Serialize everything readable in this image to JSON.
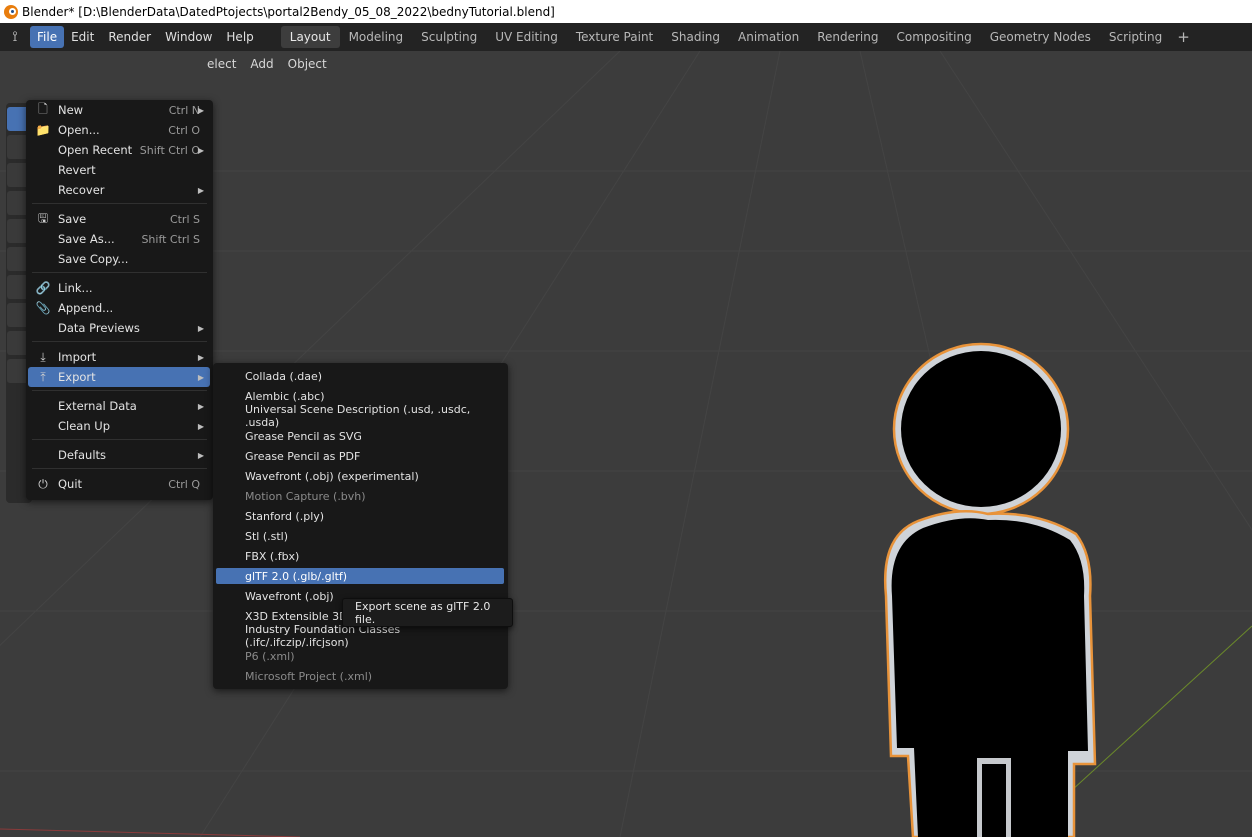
{
  "window": {
    "title": "Blender* [D:\\BlenderData\\DatedPtojects\\portal2Bendy_05_08_2022\\bednyTutorial.blend]"
  },
  "menubar": {
    "items": [
      "File",
      "Edit",
      "Render",
      "Window",
      "Help"
    ],
    "active": "File"
  },
  "workspaces": {
    "tabs": [
      "Layout",
      "Modeling",
      "Sculpting",
      "UV Editing",
      "Texture Paint",
      "Shading",
      "Animation",
      "Rendering",
      "Compositing",
      "Geometry Nodes",
      "Scripting"
    ],
    "active": "Layout",
    "add_symbol": "+"
  },
  "viewport_header": {
    "items": [
      "elect",
      "Add",
      "Object"
    ]
  },
  "file_menu": {
    "items": [
      {
        "label": "New",
        "shortcut": "Ctrl N",
        "icon": "new-file-icon",
        "glyph": "🗋",
        "submenu": true
      },
      {
        "label": "Open...",
        "shortcut": "Ctrl O",
        "icon": "folder-icon",
        "glyph": "📁",
        "submenu": false
      },
      {
        "label": "Open Recent",
        "shortcut": "Shift Ctrl O",
        "icon": "",
        "glyph": "",
        "submenu": true
      },
      {
        "label": "Revert",
        "shortcut": "",
        "icon": "",
        "glyph": "",
        "submenu": false
      },
      {
        "label": "Recover",
        "shortcut": "",
        "icon": "",
        "glyph": "",
        "submenu": true
      },
      {
        "label": "Save",
        "shortcut": "Ctrl S",
        "icon": "save-icon",
        "glyph": "🖫",
        "submenu": false
      },
      {
        "label": "Save As...",
        "shortcut": "Shift Ctrl S",
        "icon": "",
        "glyph": "",
        "submenu": false
      },
      {
        "label": "Save Copy...",
        "shortcut": "",
        "icon": "",
        "glyph": "",
        "submenu": false
      },
      {
        "label": "Link...",
        "shortcut": "",
        "icon": "link-icon",
        "glyph": "🔗",
        "submenu": false
      },
      {
        "label": "Append...",
        "shortcut": "",
        "icon": "paperclip-icon",
        "glyph": "📎",
        "submenu": false
      },
      {
        "label": "Data Previews",
        "shortcut": "",
        "icon": "",
        "glyph": "",
        "submenu": true
      },
      {
        "label": "Import",
        "shortcut": "",
        "icon": "import-icon",
        "glyph": "⤓",
        "submenu": true
      },
      {
        "label": "Export",
        "shortcut": "",
        "icon": "export-icon",
        "glyph": "⤒",
        "submenu": true,
        "highlighted": true
      },
      {
        "label": "External Data",
        "shortcut": "",
        "icon": "",
        "glyph": "",
        "submenu": true
      },
      {
        "label": "Clean Up",
        "shortcut": "",
        "icon": "",
        "glyph": "",
        "submenu": true
      },
      {
        "label": "Defaults",
        "shortcut": "",
        "icon": "",
        "glyph": "",
        "submenu": true
      },
      {
        "label": "Quit",
        "shortcut": "Ctrl Q",
        "icon": "power-icon",
        "glyph": "⏻",
        "submenu": false
      }
    ]
  },
  "export_menu": {
    "items": [
      {
        "label": "Collada (.dae)"
      },
      {
        "label": "Alembic (.abc)"
      },
      {
        "label": "Universal Scene Description (.usd, .usdc, .usda)"
      },
      {
        "label": "Grease Pencil as SVG"
      },
      {
        "label": "Grease Pencil as PDF"
      },
      {
        "label": "Wavefront (.obj) (experimental)"
      },
      {
        "label": "Motion Capture (.bvh)",
        "disabled": true
      },
      {
        "label": "Stanford (.ply)"
      },
      {
        "label": "Stl (.stl)"
      },
      {
        "label": "FBX (.fbx)"
      },
      {
        "label": "glTF 2.0 (.glb/.gltf)",
        "highlighted": true
      },
      {
        "label": "Wavefront (.obj)"
      },
      {
        "label": "X3D Extensible 3D"
      },
      {
        "label": "Industry Foundation Classes (.ifc/.ifczip/.ifcjson)"
      },
      {
        "label": "P6 (.xml)",
        "disabled": true
      },
      {
        "label": "Microsoft Project (.xml)",
        "disabled": true
      }
    ]
  },
  "tooltip": {
    "text": "Export scene as glTF 2.0 file."
  },
  "colors": {
    "accent": "#4772b3",
    "selection_outline": "#e8933a"
  }
}
